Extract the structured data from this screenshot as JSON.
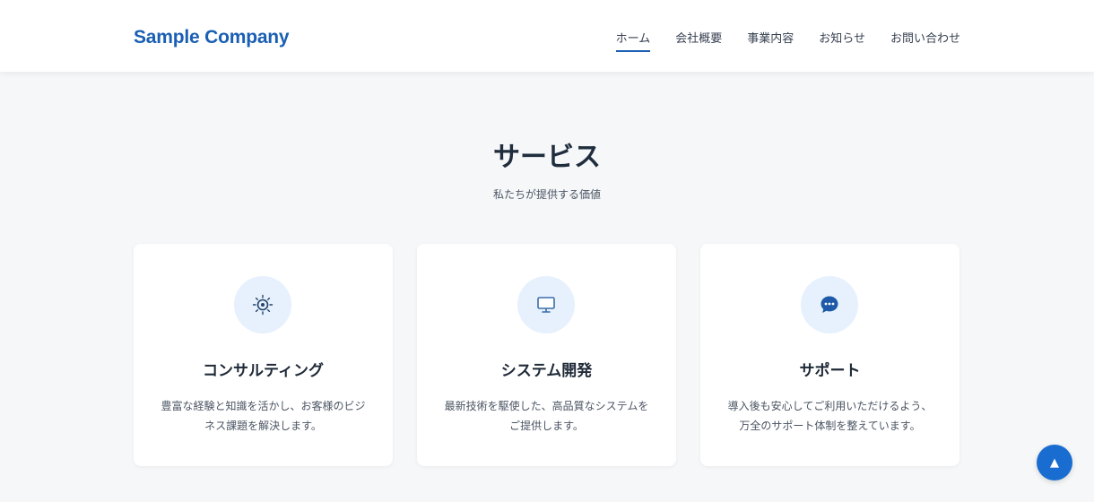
{
  "header": {
    "logo": "Sample Company",
    "nav": [
      {
        "label": "ホーム",
        "active": true
      },
      {
        "label": "会社概要"
      },
      {
        "label": "事業内容"
      },
      {
        "label": "お知らせ"
      },
      {
        "label": "お問い合わせ"
      }
    ]
  },
  "services": {
    "title": "サービス",
    "subtitle": "私たちが提供する価値",
    "cards": [
      {
        "icon": "gear-icon",
        "title": "コンサルティング",
        "desc_line1": "豊富な経験と知識を活かし、お客様のビジ",
        "desc_line2": "ネス課題を解決します。"
      },
      {
        "icon": "monitor-icon",
        "title": "システム開発",
        "desc_line1": "最新技術を駆使した、高品質なシステムを",
        "desc_line2": "ご提供します。"
      },
      {
        "icon": "chat-bubble-icon",
        "title": "サポート",
        "desc_line1": "導入後も安心してご利用いただけるよう、",
        "desc_line2": "万全のサポート体制を整えています。"
      }
    ]
  },
  "scroll_top": {
    "icon": "arrow-up-icon",
    "glyph": "▲"
  },
  "colors": {
    "accent": "#1a5fb4",
    "icon_bg": "#e6f1fd",
    "button": "#1a6dd0"
  }
}
